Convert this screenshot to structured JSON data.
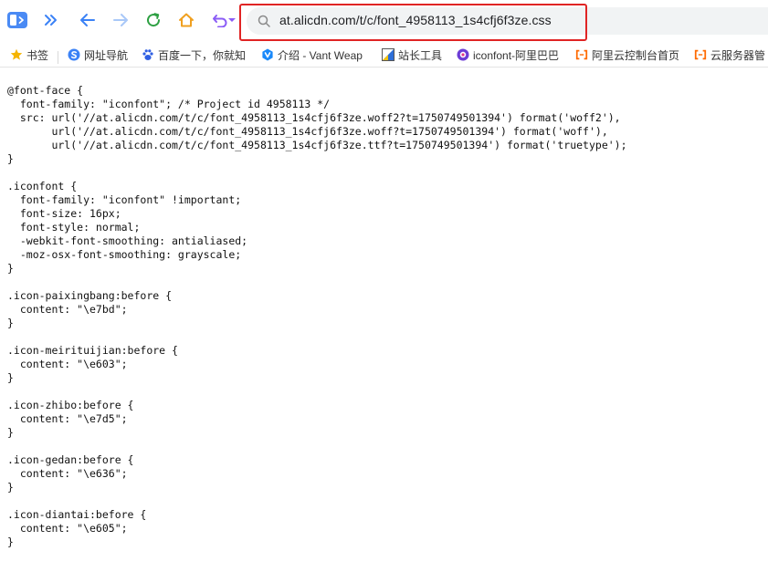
{
  "toolbar": {
    "icons": [
      "sidebar-toggle-icon",
      "double-chevron-right-icon",
      "arrow-left-icon",
      "arrow-right-icon",
      "reload-icon",
      "home-icon",
      "undo-icon",
      "chevron-down-icon",
      "search-icon"
    ]
  },
  "address": {
    "url": "at.alicdn.com/t/c/font_4958113_1s4cfj6f3ze.css"
  },
  "bookmarks": [
    {
      "label": "书签",
      "icon": "star-icon"
    },
    {
      "label": "网址导航",
      "icon": "s-logo-icon"
    },
    {
      "label": "百度一下，你就知",
      "icon": "baidu-paw-icon"
    },
    {
      "label": "介绍 - Vant Weap",
      "icon": "vant-icon"
    },
    {
      "label": "站长工具",
      "icon": "webmaster-icon"
    },
    {
      "label": "iconfont-阿里巴巴",
      "icon": "iconfont-logo-icon"
    },
    {
      "label": "阿里云控制台首页",
      "icon": "aliyun-icon"
    },
    {
      "label": "云服务器管",
      "icon": "aliyun-icon"
    }
  ],
  "code": "@font-face {\n  font-family: \"iconfont\"; /* Project id 4958113 */\n  src: url('//at.alicdn.com/t/c/font_4958113_1s4cfj6f3ze.woff2?t=1750749501394') format('woff2'),\n       url('//at.alicdn.com/t/c/font_4958113_1s4cfj6f3ze.woff?t=1750749501394') format('woff'),\n       url('//at.alicdn.com/t/c/font_4958113_1s4cfj6f3ze.ttf?t=1750749501394') format('truetype');\n}\n\n.iconfont {\n  font-family: \"iconfont\" !important;\n  font-size: 16px;\n  font-style: normal;\n  -webkit-font-smoothing: antialiased;\n  -moz-osx-font-smoothing: grayscale;\n}\n\n.icon-paixingbang:before {\n  content: \"\\e7bd\";\n}\n\n.icon-meirituijian:before {\n  content: \"\\e603\";\n}\n\n.icon-zhibo:before {\n  content: \"\\e7d5\";\n}\n\n.icon-gedan:before {\n  content: \"\\e636\";\n}\n\n.icon-diantai:before {\n  content: \"\\e605\";\n}",
  "colors": {
    "accent_blue": "#3b82f6",
    "reload_green": "#2ea043",
    "home_orange": "#f0a020",
    "undo_purple": "#8b5cf6",
    "highlight_red": "#e02424"
  }
}
